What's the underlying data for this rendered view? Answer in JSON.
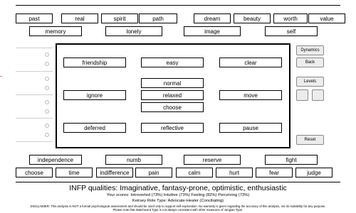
{
  "top_words_row1": [
    "past",
    "real",
    "spirit",
    "path",
    "dream",
    "beauty",
    "worth",
    "value"
  ],
  "top_words_row2": [
    "memory",
    "lonely",
    "image",
    "self"
  ],
  "stage_words": {
    "friendship": "friendship",
    "easy": "easy",
    "clear": "clear",
    "normal": "normal",
    "ignore": "ignore",
    "relaxed": "relaxed",
    "move": "move",
    "choose": "choose",
    "deferred": "deferred",
    "reflective": "reflective",
    "pause": "pause"
  },
  "bottom_words_row1": [
    "independence",
    "numb",
    "reserve",
    "fight"
  ],
  "bottom_words_row2": [
    "choose",
    "time",
    "indifference",
    "pain",
    "calm",
    "hurt",
    "fear",
    "judge"
  ],
  "side_panel": {
    "dynamics": "Dynamics",
    "back": "Back",
    "levels": "Levels",
    "reset": "Reset"
  },
  "results": {
    "title": "INFP qualities: Imaginative, fantasy-prone, optimistic, enthusiastic",
    "scores": "Your scores:  Introverted (73%)     Intuitive (73%)     Feeling (82%)     Perceiving (73%)",
    "keirsey": "Keirsey Role Type: Advocate-Healer (Conciliating)",
    "disclaimer": "DISCLAIMER: This analysis is NOT a formal psychological assessment and should be used only to support self-exploration. No warranty is given regarding the accuracy of this analysis, nor its suitability for any purpose. Please note that Watchword Type is not always consistent with other measures of Jungian Type."
  },
  "colors": {
    "accent_tick": "#e57a7a",
    "button_gray": "#ececec"
  }
}
